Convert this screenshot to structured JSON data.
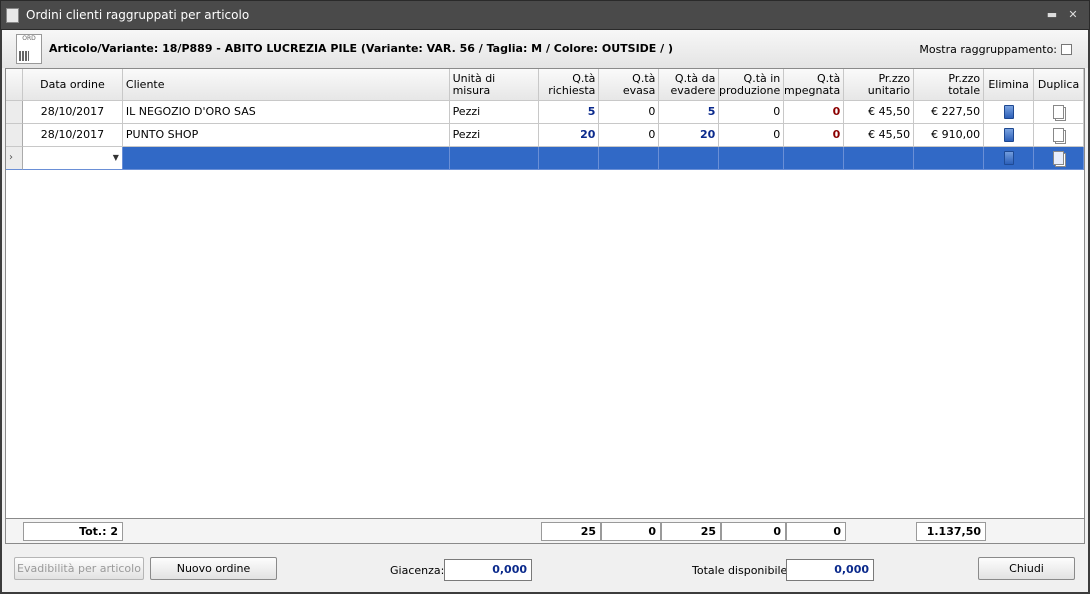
{
  "window": {
    "title": "Ordini clienti raggruppati per articolo"
  },
  "info": {
    "doc_icon_text": "ORD",
    "article": "Articolo/Variante: 18/P889 - ABITO LUCREZIA PILE (Variante: VAR. 56  / Taglia: M / Colore: OUTSIDE / )",
    "group_label": "Mostra raggruppamento:"
  },
  "columns": [
    "Data ordine",
    "Cliente",
    "Unità di misura",
    "Q.tà richiesta",
    "Q.tà evasa",
    "Q.tà da evadere",
    "Q.tà in produzione",
    "Q.tà impegnata",
    "Pr.zzo unitario",
    "Pr.zzo totale",
    "Elimina",
    "Duplica"
  ],
  "rows": [
    {
      "data": "28/10/2017",
      "cliente": "IL NEGOZIO D'ORO SAS",
      "um": "Pezzi",
      "richiesta": "5",
      "evasa": "0",
      "da_evadere": "5",
      "produzione": "0",
      "impegnata": "0",
      "unitario": "€ 45,50",
      "totale": "€ 227,50"
    },
    {
      "data": "28/10/2017",
      "cliente": "PUNTO SHOP",
      "um": "Pezzi",
      "richiesta": "20",
      "evasa": "0",
      "da_evadere": "20",
      "produzione": "0",
      "impegnata": "0",
      "unitario": "€ 45,50",
      "totale": "€ 910,00"
    }
  ],
  "totals": {
    "label": "Tot.: 2",
    "richiesta": "25",
    "evasa": "0",
    "da_evadere": "25",
    "produzione": "0",
    "impegnata": "0",
    "totale": "1.137,50"
  },
  "buttons": {
    "evadibilita": "Evadibilità per articolo",
    "nuovo": "Nuovo ordine",
    "chiudi": "Chiudi"
  },
  "giacenza": {
    "label": "Giacenza:",
    "value": "0,000"
  },
  "disponibile": {
    "label": "Totale disponibile:",
    "value": "0,000"
  },
  "colors": {
    "selection": "#3169c6",
    "qty_blue": "#0b2a8c",
    "qty_red": "#8b0000"
  }
}
